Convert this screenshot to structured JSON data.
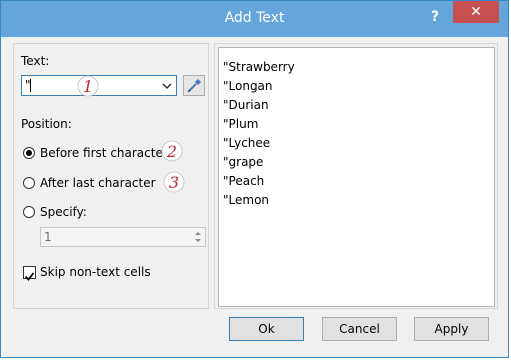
{
  "window": {
    "title": "Add Text",
    "help_glyph": "?",
    "close_glyph": "✕"
  },
  "text_section": {
    "label": "Text:",
    "value": "\""
  },
  "position": {
    "label": "Position:",
    "options": [
      {
        "label": "Before first character",
        "selected": true
      },
      {
        "label": "After last character",
        "selected": false
      },
      {
        "label": "Specify:",
        "selected": false
      }
    ],
    "specify_value": "1"
  },
  "skip_non_text": {
    "label": "Skip non-text cells",
    "checked": true
  },
  "callouts": [
    "1",
    "2",
    "3"
  ],
  "preview": {
    "items": [
      "\"Strawberry",
      "\"Longan",
      "\"Durian",
      "\"Plum",
      "\"Lychee",
      "\"grape",
      "\"Peach",
      "\"Lemon"
    ]
  },
  "buttons": {
    "ok": "Ok",
    "cancel": "Cancel",
    "apply": "Apply"
  },
  "colors": {
    "titlebar": "#64a6dc",
    "close": "#c75050",
    "callout": "#c0282d"
  },
  "icons": {
    "picker": "eyedropper-icon",
    "dropdown": "chevron-down-icon"
  }
}
